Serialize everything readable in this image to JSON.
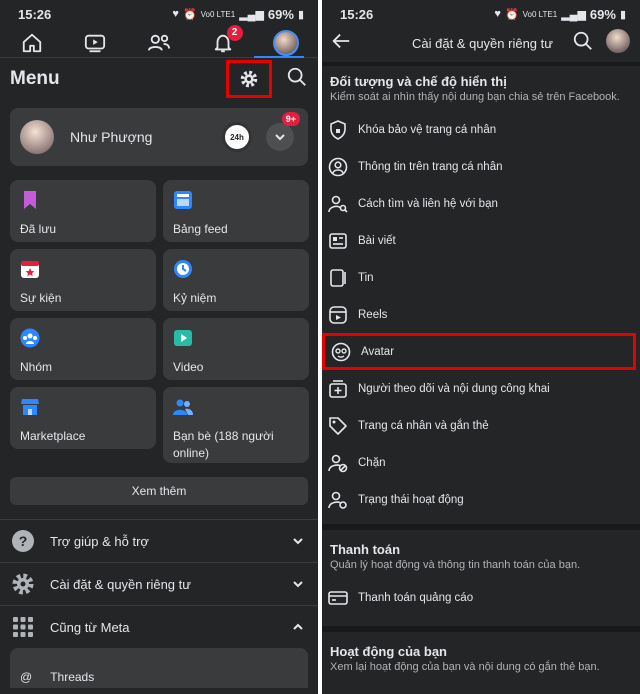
{
  "status_left": {
    "time": "15:26",
    "net": "Vo0 LTE1",
    "battery": "69%"
  },
  "status_right": {
    "time": "15:26",
    "net": "Vo0 LTE1",
    "battery": "69%"
  },
  "topnav": {
    "notif_count": "2"
  },
  "menu": {
    "title": "Menu",
    "profile_name": "Như Phượng",
    "profile_badge": "9+",
    "story_label": "24h",
    "shortcuts": [
      {
        "label": "Đã lưu",
        "icon": "bookmark-icon",
        "color": "#c35cd6"
      },
      {
        "label": "Bảng feed",
        "icon": "feed-icon",
        "color": "#2d88ff"
      },
      {
        "label": "Sự kiện",
        "icon": "calendar-icon",
        "color": "#e41e3f"
      },
      {
        "label": "Kỷ niệm",
        "icon": "clock-icon",
        "color": "#2d88ff"
      },
      {
        "label": "Nhóm",
        "icon": "groups-icon",
        "color": "#2d88ff"
      },
      {
        "label": "Video",
        "icon": "video-icon",
        "color": "#2abba7"
      },
      {
        "label": "Marketplace",
        "icon": "store-icon",
        "color": "#2d88ff"
      },
      {
        "label": "Bạn bè (188 người online)",
        "icon": "friends-icon",
        "color": "#2d88ff"
      }
    ],
    "see_more": "Xem thêm",
    "sections": [
      {
        "label": "Trợ giúp & hỗ trợ",
        "icon": "help-icon"
      },
      {
        "label": "Cài đặt & quyền riêng tư",
        "icon": "settings-icon"
      },
      {
        "label": "Cũng từ Meta",
        "icon": "apps-grid-icon"
      }
    ],
    "threads_label": "Threads"
  },
  "settings": {
    "title": "Cài đặt & quyền riêng tư",
    "audience": {
      "title": "Đối tượng và chế độ hiển thị",
      "desc": "Kiểm soát ai nhìn thấy nội dung bạn chia sẻ trên Facebook.",
      "items": [
        {
          "label": "Khóa bảo vệ trang cá nhân",
          "icon": "shield-lock-icon"
        },
        {
          "label": "Thông tin trên trang cá nhân",
          "icon": "profile-info-icon"
        },
        {
          "label": "Cách tìm và liên hệ với bạn",
          "icon": "find-contact-icon"
        },
        {
          "label": "Bài viết",
          "icon": "posts-icon"
        },
        {
          "label": "Tin",
          "icon": "stories-icon"
        },
        {
          "label": "Reels",
          "icon": "reels-icon"
        },
        {
          "label": "Avatar",
          "icon": "avatar-face-icon"
        },
        {
          "label": "Người theo dõi và nội dung công khai",
          "icon": "followers-icon"
        },
        {
          "label": "Trang cá nhân và gắn thẻ",
          "icon": "tag-icon"
        },
        {
          "label": "Chặn",
          "icon": "block-user-icon"
        },
        {
          "label": "Trạng thái hoạt động",
          "icon": "active-status-icon"
        }
      ]
    },
    "payments": {
      "title": "Thanh toán",
      "desc": "Quản lý hoạt động và thông tin thanh toán của bạn.",
      "items": [
        {
          "label": "Thanh toán quảng cáo",
          "icon": "card-icon"
        }
      ]
    },
    "activity": {
      "title": "Hoạt động của bạn",
      "desc": "Xem lại hoạt động của bạn và nội dung có gắn thẻ bạn."
    }
  }
}
